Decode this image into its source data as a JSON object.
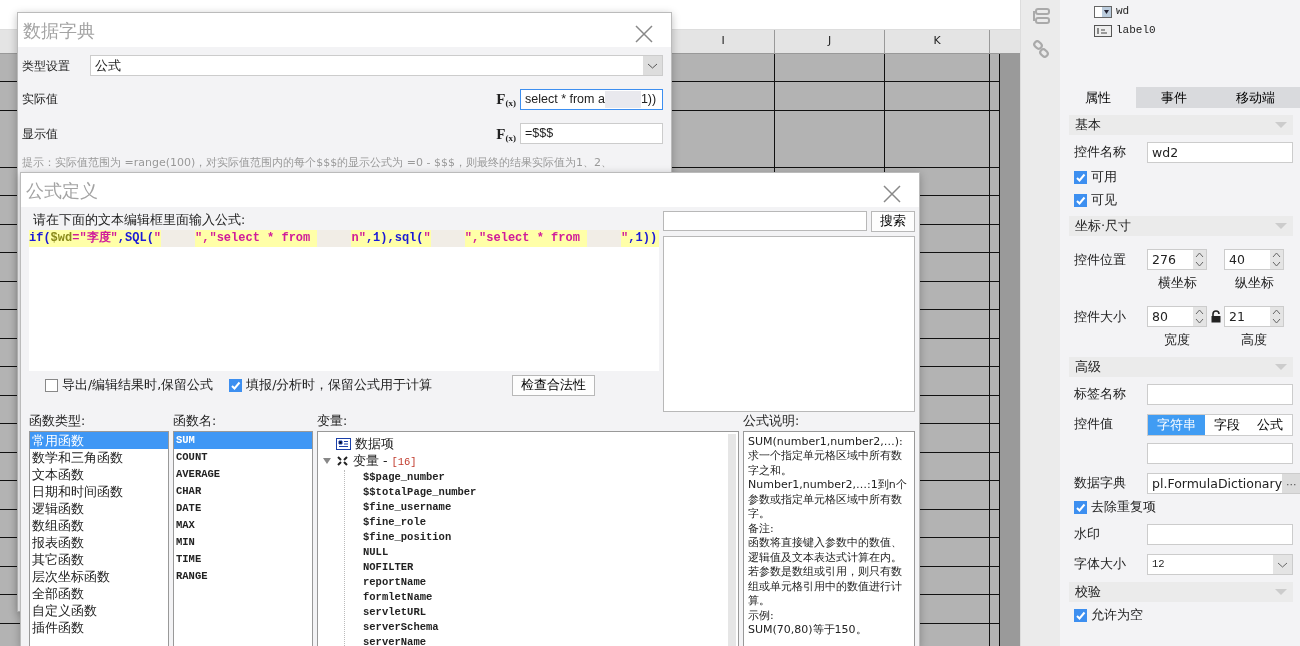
{
  "sheet": {
    "columns": [
      "I",
      "J",
      "K"
    ]
  },
  "dict_dialog": {
    "title": "数据字典",
    "type_label": "类型设置",
    "type_value": "公式",
    "actual": {
      "label": "实际值",
      "fx": "F$_{(x)}$",
      "value_start": "select * from a",
      "value_end": "1))"
    },
    "display": {
      "label": "显示值",
      "fx": "F$_{(x)}$",
      "value": "=$$$"
    },
    "hint": "提示：实际值范围为 =range(100)，对实际值范围内的每个$$$的显示公式为 =0 - $$$，则最终的结果实际值为1、2、"
  },
  "formula_dialog": {
    "title": "公式定义",
    "prompt": "请在下面的文本编辑框里面输入公式:",
    "tokens": [
      {
        "kind": "func",
        "text": "if("
      },
      {
        "kind": "var",
        "text": "$wd"
      },
      {
        "kind": "str",
        "text": "=\"李度\""
      },
      {
        "kind": "func",
        "text": ",SQL("
      },
      {
        "kind": "str",
        "text": "\""
      },
      {
        "kind": "redacted"
      },
      {
        "kind": "str",
        "text": "\",\"select * from "
      },
      {
        "kind": "redacted"
      },
      {
        "kind": "str",
        "text": "n\""
      },
      {
        "kind": "func",
        "text": ",1),sql("
      },
      {
        "kind": "str",
        "text": "\""
      },
      {
        "kind": "redacted"
      },
      {
        "kind": "str",
        "text": "\",\"select * from "
      },
      {
        "kind": "redacted"
      },
      {
        "kind": "str",
        "text": "\""
      },
      {
        "kind": "func",
        "text": ",1))"
      }
    ],
    "search_button": "搜索",
    "options": [
      {
        "label": "导出/编辑结果时,保留公式",
        "checked": false
      },
      {
        "label": "填报/分析时，保留公式用于计算",
        "checked": true
      }
    ],
    "check_button": "检查合法性",
    "function_types": {
      "heading": "函数类型:",
      "items": [
        {
          "label": "常用函数",
          "selected": true
        },
        {
          "label": "数学和三角函数",
          "selected": false
        },
        {
          "label": "文本函数",
          "selected": false
        },
        {
          "label": "日期和时间函数",
          "selected": false
        },
        {
          "label": "逻辑函数",
          "selected": false
        },
        {
          "label": "数组函数",
          "selected": false
        },
        {
          "label": "报表函数",
          "selected": false
        },
        {
          "label": "其它函数",
          "selected": false
        },
        {
          "label": "层次坐标函数",
          "selected": false
        },
        {
          "label": "全部函数",
          "selected": false
        },
        {
          "label": "自定义函数",
          "selected": false
        },
        {
          "label": "插件函数",
          "selected": false
        }
      ]
    },
    "function_names": {
      "heading": "函数名:",
      "items": [
        {
          "label": "SUM",
          "selected": true
        },
        {
          "label": "COUNT",
          "selected": false
        },
        {
          "label": "AVERAGE",
          "selected": false
        },
        {
          "label": "CHAR",
          "selected": false
        },
        {
          "label": "DATE",
          "selected": false
        },
        {
          "label": "MAX",
          "selected": false
        },
        {
          "label": "MIN",
          "selected": false
        },
        {
          "label": "TIME",
          "selected": false
        },
        {
          "label": "RANGE",
          "selected": false
        }
      ]
    },
    "variables": {
      "heading": "变量:",
      "tree": [
        {
          "kind": "dataset",
          "label": "数据项"
        },
        {
          "kind": "group",
          "label": "变量 - ",
          "count": "[16]",
          "expanded": true,
          "children": [
            {
              "label": "$$page_number"
            },
            {
              "label": "$$totalPage_number"
            },
            {
              "label": "$fine_username"
            },
            {
              "label": "$fine_role"
            },
            {
              "label": "$fine_position"
            },
            {
              "label": "NULL"
            },
            {
              "label": "NOFILTER"
            },
            {
              "label": "reportName"
            },
            {
              "label": "formletName"
            },
            {
              "label": "servletURL"
            },
            {
              "label": "serverSchema"
            },
            {
              "label": "serverName"
            }
          ]
        }
      ]
    },
    "description": {
      "heading": "公式说明:",
      "paragraphs": [
        "SUM(number1,number2,…):求一个指定单元格区域中所有数字之和。",
        "Number1,number2,…:1到n个参数或指定单元格区域中所有数字。",
        "备注:",
        "函数将直接键入参数中的数值、逻辑值及文本表达式计算在内。若参数是数组或引用，则只有数组或单元格引用中的数值进行计算。",
        "示例:",
        "SUM(70,80)等于150。"
      ]
    }
  },
  "widget_tree": [
    {
      "kind": "combo",
      "label": "wd"
    },
    {
      "kind": "label",
      "label": "label0"
    }
  ],
  "properties": {
    "tabs": [
      {
        "label": "属性",
        "selected": true
      },
      {
        "label": "事件",
        "selected": false
      },
      {
        "label": "移动端",
        "selected": false
      }
    ],
    "sections": [
      {
        "title": "基本",
        "rows": [
          {
            "kind": "text",
            "label": "控件名称",
            "value": "wd2"
          },
          {
            "kind": "check",
            "label": "可用",
            "checked": true
          },
          {
            "kind": "check",
            "label": "可见",
            "checked": true
          }
        ]
      },
      {
        "title": "坐标·尺寸",
        "rows": [
          {
            "kind": "spin",
            "label": "控件位置",
            "fields": [
              {
                "value": "276",
                "caption": "横坐标"
              },
              {
                "value": "40",
                "caption": "纵坐标"
              }
            ]
          },
          {
            "kind": "spin",
            "label": "控件大小",
            "locked": false,
            "fields": [
              {
                "value": "80",
                "caption": "宽度"
              },
              {
                "value": "21",
                "caption": "高度"
              }
            ]
          }
        ]
      },
      {
        "title": "高级",
        "rows": [
          {
            "kind": "text",
            "label": "标签名称"
          },
          {
            "kind": "segmented",
            "label": "控件值",
            "options": [
              {
                "label": "字符串",
                "selected": true
              },
              {
                "label": "字段",
                "selected": false
              },
              {
                "label": "公式",
                "selected": false
              }
            ]
          },
          {
            "kind": "text"
          },
          {
            "kind": "picker",
            "label": "数据字典",
            "value": "pl.FormulaDictionary",
            "button": "···"
          },
          {
            "kind": "check",
            "label": "去除重复项",
            "checked": true
          },
          {
            "kind": "text",
            "label": "水印"
          },
          {
            "kind": "select",
            "label": "字体大小",
            "value": "12"
          }
        ]
      },
      {
        "title": "校验",
        "rows": [
          {
            "kind": "check",
            "label": "允许为空",
            "checked": true
          }
        ]
      }
    ]
  }
}
